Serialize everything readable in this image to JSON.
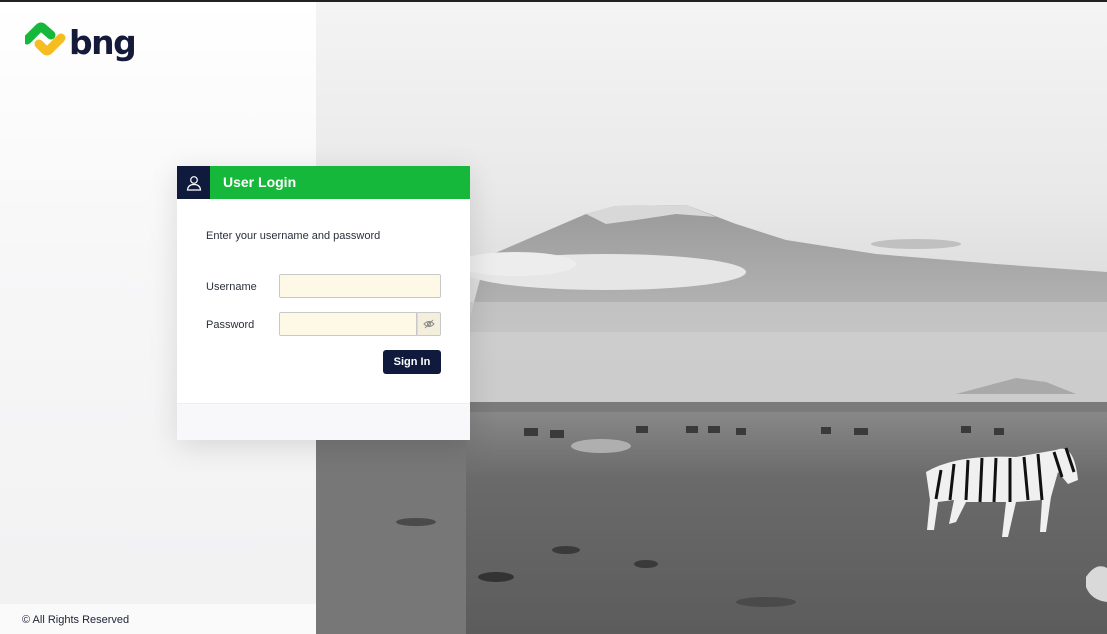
{
  "brand": {
    "name": "bng",
    "green": "#15b83a",
    "navy": "#101a3d",
    "yellow": "#f5bd1f"
  },
  "login": {
    "title": "User Login",
    "instructions": "Enter your username and password",
    "username_label": "Username",
    "password_label": "Password",
    "username_value": "",
    "password_value": "",
    "signin_label": "Sign In",
    "user_icon": "user-icon",
    "eye_icon": "eye-slash-icon"
  },
  "footer": {
    "text": "© All Rights Reserved"
  },
  "background": {
    "subject": "black-and-white savanna photo with mountain and zebras"
  }
}
